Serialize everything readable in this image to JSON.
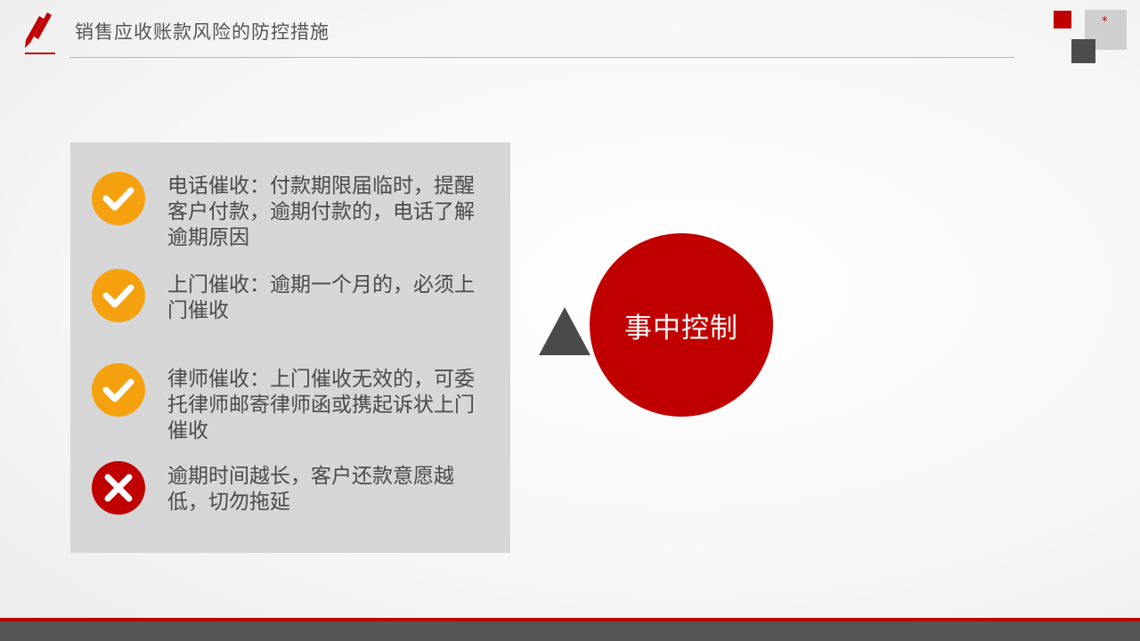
{
  "header": {
    "title": "销售应收账款风险的防控措施",
    "icon": "pencil-icon"
  },
  "decor": {
    "star": "*",
    "accent_color": "#c00000",
    "dark_color": "#4d4d4d",
    "light_color": "#cfcfcf"
  },
  "panel": {
    "items": [
      {
        "status": "check",
        "icon": "check-circle-icon",
        "text": "电话催收：付款期限届临时，提醒客户付款，逾期付款的，电话了解逾期原因"
      },
      {
        "status": "check",
        "icon": "check-circle-icon",
        "text": "上门催收：逾期一个月的，必须上门催收"
      },
      {
        "status": "check",
        "icon": "check-circle-icon",
        "text": "律师催收：上门催收无效的，可委托律师邮寄律师函或携起诉状上门催收"
      },
      {
        "status": "cross",
        "icon": "cross-circle-icon",
        "text": "逾期时间越长，客户还款意愿越低，切勿拖延"
      }
    ],
    "check_color": "#f5a10f",
    "cross_color": "#c00000"
  },
  "main": {
    "circle_label": "事中控制"
  }
}
